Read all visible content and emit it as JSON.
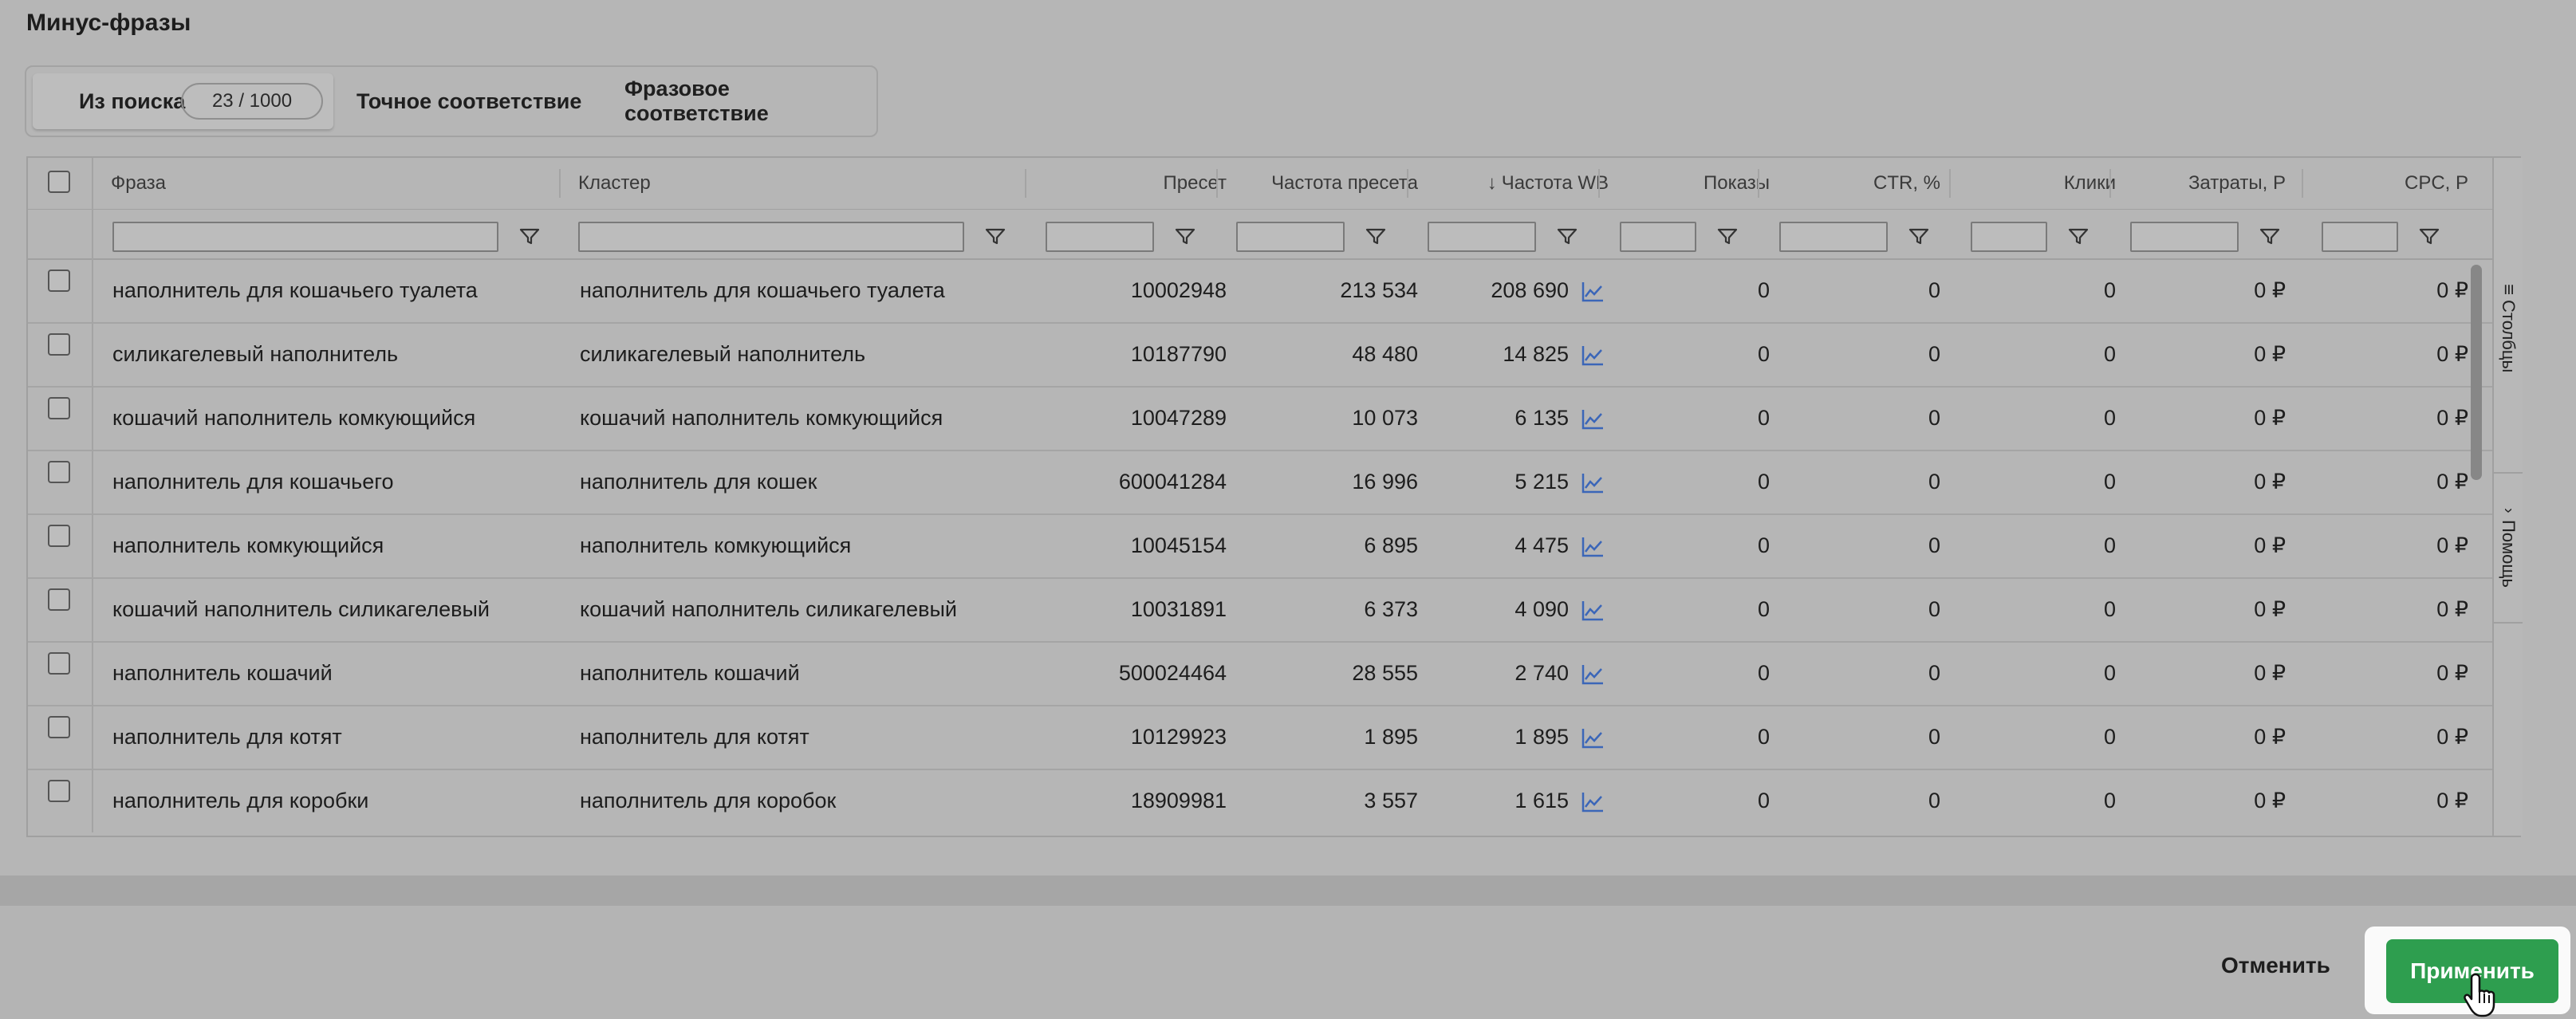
{
  "title": "Минус-фразы",
  "tabs": {
    "search": {
      "label": "Из поиска",
      "badge": "23 / 1000"
    },
    "exact": {
      "label": "Точное соответствие"
    },
    "phrase": {
      "label": "Фразовое соответствие"
    }
  },
  "columns": {
    "phrase": "Фраза",
    "cluster": "Кластер",
    "preset": "Пресет",
    "preset_freq": "Частота пресета",
    "wb_freq": "Частота WB",
    "impressions": "Показы",
    "ctr": "CTR, %",
    "clicks": "Клики",
    "costs": "Затраты, Р",
    "cpc": "CPC, Р"
  },
  "rows": [
    {
      "phrase": "наполнитель для кошачьего туалета",
      "cluster": "наполнитель для кошачьего туалета",
      "preset": "10002948",
      "preset_freq": "213 534",
      "wb_freq": "208 690",
      "impressions": "0",
      "ctr": "0",
      "clicks": "0",
      "costs": "0 ₽",
      "cpc": "0 ₽"
    },
    {
      "phrase": "силикагелевый наполнитель",
      "cluster": "силикагелевый наполнитель",
      "preset": "10187790",
      "preset_freq": "48 480",
      "wb_freq": "14 825",
      "impressions": "0",
      "ctr": "0",
      "clicks": "0",
      "costs": "0 ₽",
      "cpc": "0 ₽"
    },
    {
      "phrase": "кошачий наполнитель комкующийся",
      "cluster": "кошачий наполнитель комкующийся",
      "preset": "10047289",
      "preset_freq": "10 073",
      "wb_freq": "6 135",
      "impressions": "0",
      "ctr": "0",
      "clicks": "0",
      "costs": "0 ₽",
      "cpc": "0 ₽"
    },
    {
      "phrase": "наполнитель для кошачьего",
      "cluster": "наполнитель для кошек",
      "preset": "600041284",
      "preset_freq": "16 996",
      "wb_freq": "5 215",
      "impressions": "0",
      "ctr": "0",
      "clicks": "0",
      "costs": "0 ₽",
      "cpc": "0 ₽"
    },
    {
      "phrase": "наполнитель комкующийся",
      "cluster": "наполнитель комкующийся",
      "preset": "10045154",
      "preset_freq": "6 895",
      "wb_freq": "4 475",
      "impressions": "0",
      "ctr": "0",
      "clicks": "0",
      "costs": "0 ₽",
      "cpc": "0 ₽"
    },
    {
      "phrase": "кошачий наполнитель силикагелевый",
      "cluster": "кошачий наполнитель силикагелевый",
      "preset": "10031891",
      "preset_freq": "6 373",
      "wb_freq": "4 090",
      "impressions": "0",
      "ctr": "0",
      "clicks": "0",
      "costs": "0 ₽",
      "cpc": "0 ₽"
    },
    {
      "phrase": "наполнитель кошачий",
      "cluster": "наполнитель кошачий",
      "preset": "500024464",
      "preset_freq": "28 555",
      "wb_freq": "2 740",
      "impressions": "0",
      "ctr": "0",
      "clicks": "0",
      "costs": "0 ₽",
      "cpc": "0 ₽"
    },
    {
      "phrase": "наполнитель для котят",
      "cluster": "наполнитель для котят",
      "preset": "10129923",
      "preset_freq": "1 895",
      "wb_freq": "1 895",
      "impressions": "0",
      "ctr": "0",
      "clicks": "0",
      "costs": "0 ₽",
      "cpc": "0 ₽"
    },
    {
      "phrase": "наполнитель для коробки",
      "cluster": "наполнитель для коробок",
      "preset": "18909981",
      "preset_freq": "3 557",
      "wb_freq": "1 615",
      "impressions": "0",
      "ctr": "0",
      "clicks": "0",
      "costs": "0 ₽",
      "cpc": "0 ₽"
    }
  ],
  "side": {
    "columns": "Столбцы",
    "help": "Помощь"
  },
  "footer": {
    "cancel": "Отменить",
    "apply": "Применить"
  },
  "colors": {
    "accent": "#2e9e4f",
    "trend_icon": "#3b66b8"
  },
  "icons": {
    "filter": "filter-icon",
    "trend": "trend-chart-icon",
    "sort": "sort-down-arrow-icon"
  }
}
